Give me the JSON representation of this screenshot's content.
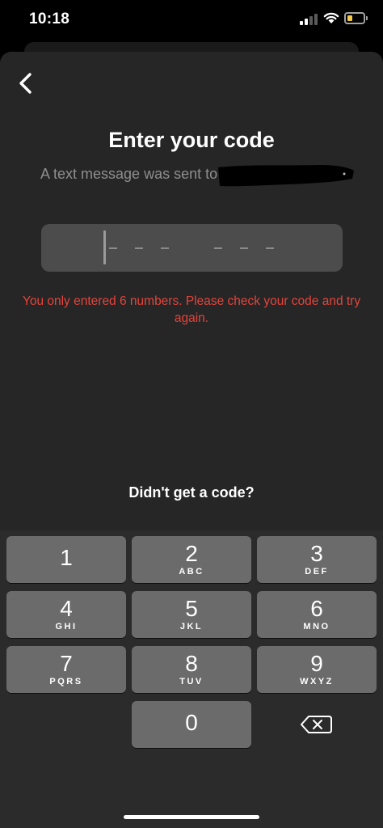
{
  "status_bar": {
    "time": "10:18",
    "battery_color": "#f2c94c"
  },
  "header": {
    "back_icon": "chevron-left-icon"
  },
  "main": {
    "title": "Enter your code",
    "subtitle": "A text message was sent to",
    "error_message": "You only entered 6 numbers. Please check your code and try again.",
    "error_color": "#e5443c",
    "resend_label": "Didn't get a code?"
  },
  "keypad": {
    "keys": [
      {
        "digit": "1",
        "letters": ""
      },
      {
        "digit": "2",
        "letters": "ABC"
      },
      {
        "digit": "3",
        "letters": "DEF"
      },
      {
        "digit": "4",
        "letters": "GHI"
      },
      {
        "digit": "5",
        "letters": "JKL"
      },
      {
        "digit": "6",
        "letters": "MNO"
      },
      {
        "digit": "7",
        "letters": "PQRS"
      },
      {
        "digit": "8",
        "letters": "TUV"
      },
      {
        "digit": "9",
        "letters": "WXYZ"
      },
      {
        "digit": "0",
        "letters": ""
      }
    ],
    "delete_icon": "backspace-icon"
  }
}
